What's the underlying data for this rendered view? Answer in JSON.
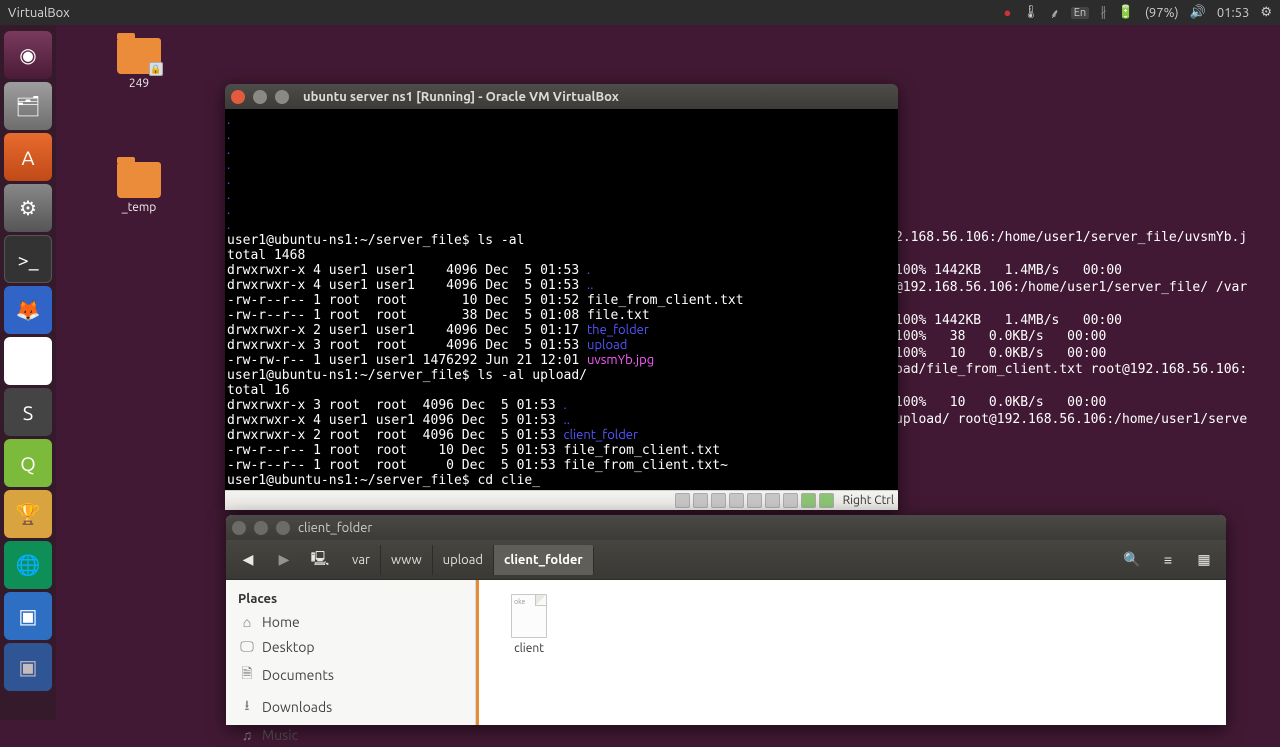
{
  "menubar": {
    "app": "VirtualBox",
    "lang": "En",
    "battery": "(97%)",
    "time": "01:53"
  },
  "desktop": {
    "icon1": {
      "label": "249"
    },
    "icon2": {
      "label": "_temp"
    }
  },
  "bg_terminal": {
    "l1": "2.168.56.106:/home/user1/server_file/uvsmYb.j",
    "l2": "",
    "l3": "100% 1442KB   1.4MB/s   00:00",
    "l4": "@192.168.56.106:/home/user1/server_file/ /var",
    "l5": "",
    "l6": "100% 1442KB   1.4MB/s   00:00",
    "l7": "100%   38   0.0KB/s   00:00",
    "l8": "100%   10   0.0KB/s   00:00",
    "l9": "oad/file_from_client.txt root@192.168.56.106:",
    "l10": "",
    "l11": "100%   10   0.0KB/s   00:00",
    "l12": "upload/ root@192.168.56.106:/home/user1/serve"
  },
  "vbox": {
    "title": "ubuntu server ns1 [Running] - Oracle VM VirtualBox",
    "status_hostkey": "Right Ctrl",
    "term": {
      "r": [
        {
          "t": "user1@ubuntu-ns1:~/server_file$ ls -al"
        },
        {
          "t": "total 1468"
        },
        {
          "t": "drwxrwxr-x 4 user1 user1    4096 Dec  5 01:53 ",
          "s": ".",
          "c": "c-blue"
        },
        {
          "t": "drwxrwxr-x 4 user1 user1    4096 Dec  5 01:53 ",
          "s": "..",
          "c": "c-blue"
        },
        {
          "t": "-rw-r--r-- 1 root  root       10 Dec  5 01:52 file_from_client.txt"
        },
        {
          "t": "-rw-r--r-- 1 root  root       38 Dec  5 01:08 file.txt"
        },
        {
          "t": "drwxrwxr-x 2 user1 user1    4096 Dec  5 01:17 ",
          "s": "the_folder",
          "c": "c-blue"
        },
        {
          "t": "drwxrwxr-x 3 root  root     4096 Dec  5 01:53 ",
          "s": "upload",
          "c": "c-blue"
        },
        {
          "t": "-rw-rw-r-- 1 user1 user1 1476292 Jun 21 12:01 ",
          "s": "uvsmYb.jpg",
          "c": "c-mag"
        },
        {
          "t": "user1@ubuntu-ns1:~/server_file$ ls -al upload/"
        },
        {
          "t": "total 16"
        },
        {
          "t": "drwxrwxr-x 3 root  root  4096 Dec  5 01:53 ",
          "s": ".",
          "c": "c-blue"
        },
        {
          "t": "drwxrwxr-x 4 user1 user1 4096 Dec  5 01:53 ",
          "s": "..",
          "c": "c-blue"
        },
        {
          "t": "drwxrwxr-x 2 root  root  4096 Dec  5 01:53 ",
          "s": "client_folder",
          "c": "c-blue"
        },
        {
          "t": "-rw-r--r-- 1 root  root    10 Dec  5 01:53 file_from_client.txt"
        },
        {
          "t": "-rw-r--r-- 1 root  root     0 Dec  5 01:53 file_from_client.txt~"
        },
        {
          "t": "user1@ubuntu-ns1:~/server_file$ cd clie_"
        }
      ]
    }
  },
  "files": {
    "title": "client_folder",
    "breadcrumbs": [
      "var",
      "www",
      "upload",
      "client_folder"
    ],
    "sidebar": {
      "heading": "Places",
      "items": [
        "Home",
        "Desktop",
        "Documents",
        "Downloads",
        "Music"
      ]
    },
    "content": {
      "file1_snippet": "oke",
      "file1": "client"
    }
  }
}
